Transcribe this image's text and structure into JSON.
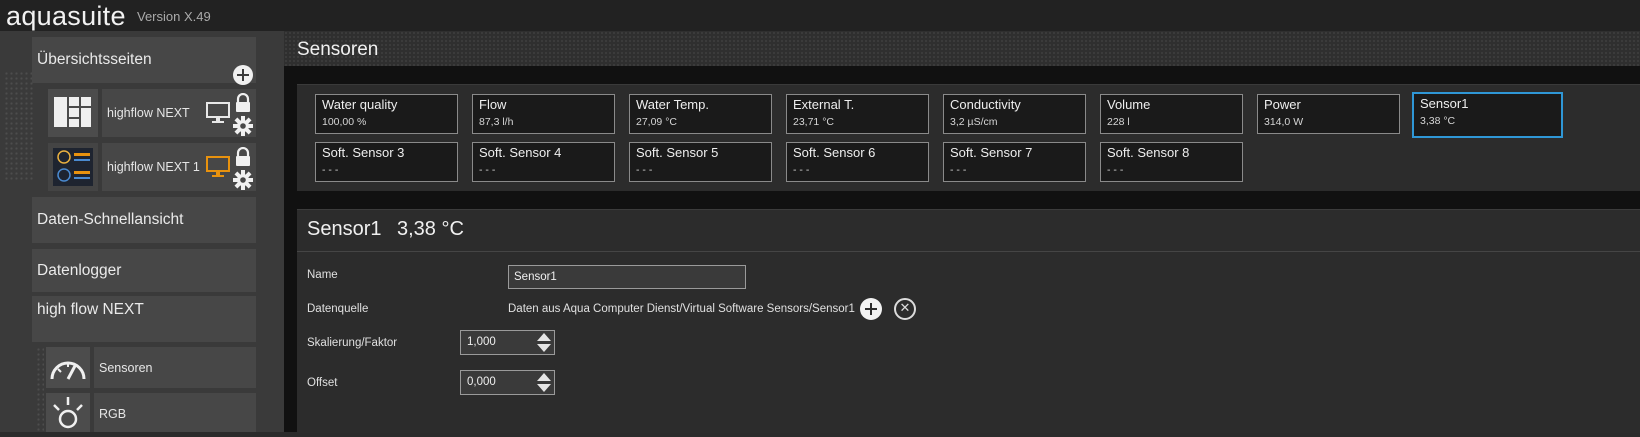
{
  "app": {
    "name": "aquasuite",
    "version": "Version X.49"
  },
  "sidebar": {
    "overview_label": "Übersichtsseiten",
    "pages": [
      {
        "label": "highflow NEXT",
        "monitor_color": "#e8e8e8"
      },
      {
        "label": "highflow NEXT 1",
        "monitor_color": "#e8920e"
      }
    ],
    "quickview_label": "Daten-Schnellansicht",
    "datalogger_label": "Datenlogger",
    "device_label": "high flow NEXT",
    "device_items": [
      {
        "label": "Sensoren",
        "icon": "gauge-icon"
      },
      {
        "label": "RGB",
        "icon": "light-icon"
      }
    ]
  },
  "main": {
    "title": "Sensoren",
    "tiles": [
      {
        "name": "Water quality",
        "value": "100,00 %"
      },
      {
        "name": "Flow",
        "value": "87,3 l/h"
      },
      {
        "name": "Water Temp.",
        "value": "27,09 °C"
      },
      {
        "name": "External T.",
        "value": "23,71 °C"
      },
      {
        "name": "Conductivity",
        "value": "3,2 µS/cm"
      },
      {
        "name": "Volume",
        "value": "228 l"
      },
      {
        "name": "Power",
        "value": "314,0 W"
      },
      {
        "name": "Sensor1",
        "value": "3,38 °C",
        "active": true
      },
      {
        "name": "Soft. Sensor 3",
        "value": "- - -"
      },
      {
        "name": "Soft. Sensor 4",
        "value": "- - -"
      },
      {
        "name": "Soft. Sensor 5",
        "value": "- - -"
      },
      {
        "name": "Soft. Sensor 6",
        "value": "- - -"
      },
      {
        "name": "Soft. Sensor 7",
        "value": "- - -"
      },
      {
        "name": "Soft. Sensor 8",
        "value": "- - -"
      }
    ],
    "detail": {
      "title": "Sensor1",
      "value": "3,38 °C",
      "name_label": "Name",
      "name_value": "Sensor1",
      "source_label": "Datenquelle",
      "source_value": "Daten aus Aqua Computer Dienst/Virtual Software Sensors/Sensor1",
      "scale_label": "Skalierung/Faktor",
      "scale_value": "1,000",
      "offset_label": "Offset",
      "offset_value": "0,000"
    }
  },
  "colors": {
    "accent": "#2f97d6",
    "orange_monitor": "#e8920e"
  }
}
